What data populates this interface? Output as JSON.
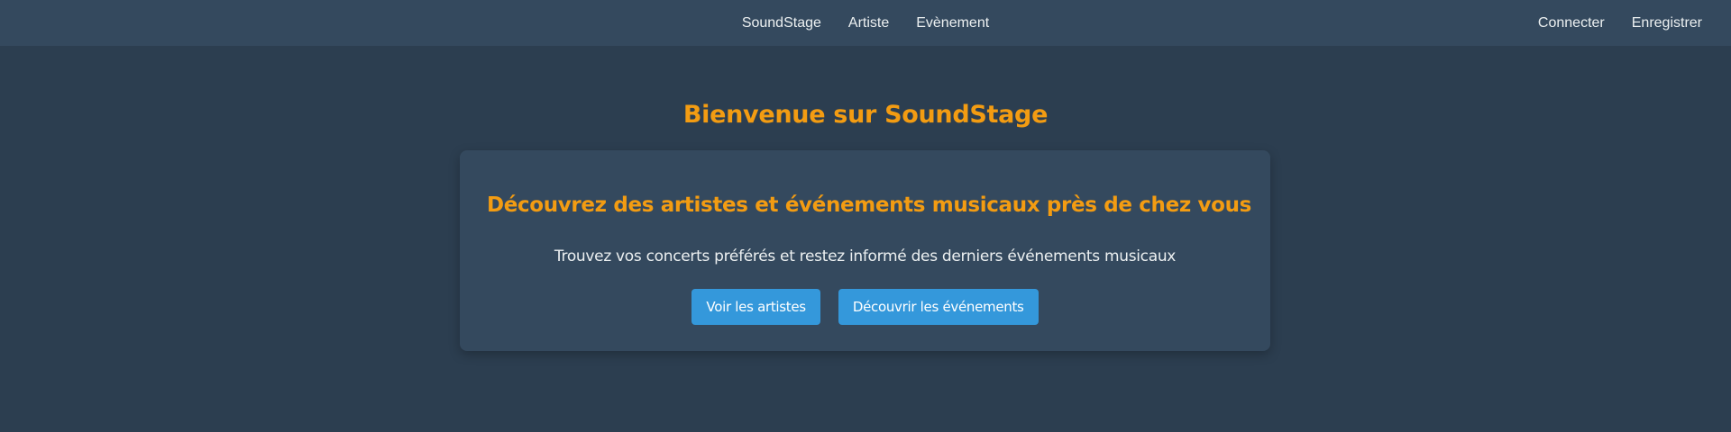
{
  "nav": {
    "links": [
      "SoundStage",
      "Artiste",
      "Evènement"
    ],
    "auth": {
      "login": "Connecter",
      "register": "Enregistrer"
    }
  },
  "main": {
    "title": "Bienvenue sur SoundStage",
    "hero": {
      "heading": "Découvrez des artistes et événements musicaux près de chez vous",
      "subtitle": "Trouvez vos concerts préférés et restez informé des derniers événements musicaux",
      "buttons": {
        "artists": "Voir les artistes",
        "events": "Découvrir les événements"
      }
    }
  },
  "colors": {
    "background": "#2c3e50",
    "surface": "#34495e",
    "accent": "#f39c12",
    "primary_button": "#3498db",
    "text": "#ecf0f1"
  }
}
